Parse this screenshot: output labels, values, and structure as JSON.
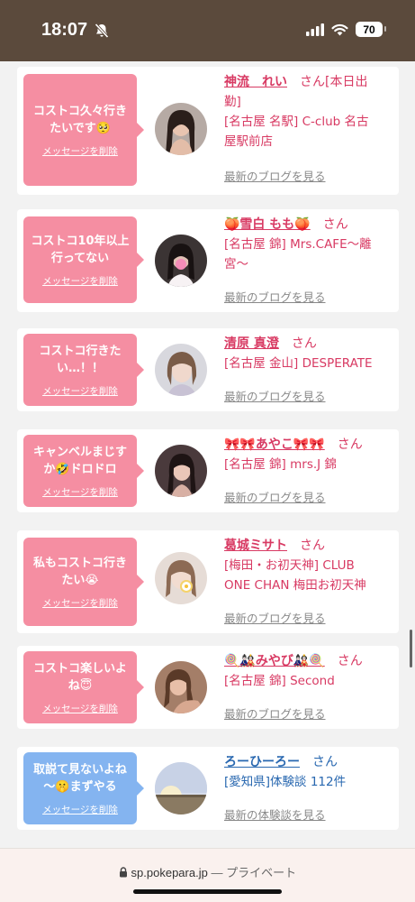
{
  "status_bar": {
    "time": "18:07",
    "battery": "70",
    "icons": [
      "bell-slash-icon",
      "signal-icon",
      "wifi-icon",
      "battery-icon"
    ]
  },
  "colors": {
    "header": "#5b4a3c",
    "bubble_pink": "#f58ea2",
    "bubble_blue": "#84b4f0",
    "name_pink": "#d83a63",
    "name_blue": "#2968b0"
  },
  "cards": [
    {
      "message_lines": [
        "コストコ久々行き",
        "たいです🥺"
      ],
      "delete": "メッセージを削除",
      "name": "神流　れい",
      "san": "さん",
      "shop_lines": [
        "[本日出",
        "勤]",
        "[名古屋 名駅] C-club 名古",
        "屋駅前店"
      ],
      "link": "最新のブログを見る",
      "avatar_icon": "person-avatar"
    },
    {
      "message_lines": [
        "コストコ10年以上",
        "行ってない"
      ],
      "delete": "メッセージを削除",
      "name": "🍑雪白 もも🍑",
      "san": "さん",
      "shop_lines": [
        "[名古屋 錦] Mrs.CAFE～離",
        "宮～"
      ],
      "link": "最新のブログを見る",
      "avatar_icon": "person-avatar"
    },
    {
      "message_lines": [
        "コストコ行きた",
        "い…！！"
      ],
      "delete": "メッセージを削除",
      "name": "清原 真澄",
      "san": "さん",
      "shop_lines": [
        "[名古屋 金山] DESPERATE"
      ],
      "link": "最新のブログを見る",
      "avatar_icon": "person-avatar"
    },
    {
      "message_lines": [
        "キャンベルまじす",
        "か🤣ドロドロ"
      ],
      "delete": "メッセージを削除",
      "name": "🎀🎀あやこ🎀🎀",
      "san": "さん",
      "shop_lines": [
        "[名古屋 錦] mrs.J 錦"
      ],
      "link": "最新のブログを見る",
      "avatar_icon": "person-avatar"
    },
    {
      "message_lines": [
        "私もコストコ行き",
        "たい😭"
      ],
      "delete": "メッセージを削除",
      "name": "葛城ミサト",
      "san": "さん",
      "shop_lines": [
        "[梅田・お初天神] CLUB",
        "ONE CHAN 梅田お初天神"
      ],
      "link": "最新のブログを見る",
      "avatar_icon": "person-avatar"
    },
    {
      "message_lines": [
        "コストコ楽しいよ",
        "ね😇"
      ],
      "delete": "メッセージを削除",
      "name": "🍭🎎みやび🎎🍭",
      "san": "さん",
      "shop_lines": [
        "[名古屋 錦] Second"
      ],
      "link": "最新のブログを見る",
      "avatar_icon": "person-avatar"
    },
    {
      "message_lines": [
        "取説て見ないよね",
        "〜🤫まずやる"
      ],
      "delete": "メッセージを削除",
      "name": "ろーひーろー",
      "san": "さん",
      "shop_lines": [
        "[愛知県]体験談 112件"
      ],
      "link": "最新の体験談を見る",
      "avatar_icon": "sunset-avatar"
    }
  ],
  "url_bar": {
    "lock_icon": "lock-icon",
    "url": "sp.pokepara.jp",
    "suffix": "— プライベート"
  }
}
